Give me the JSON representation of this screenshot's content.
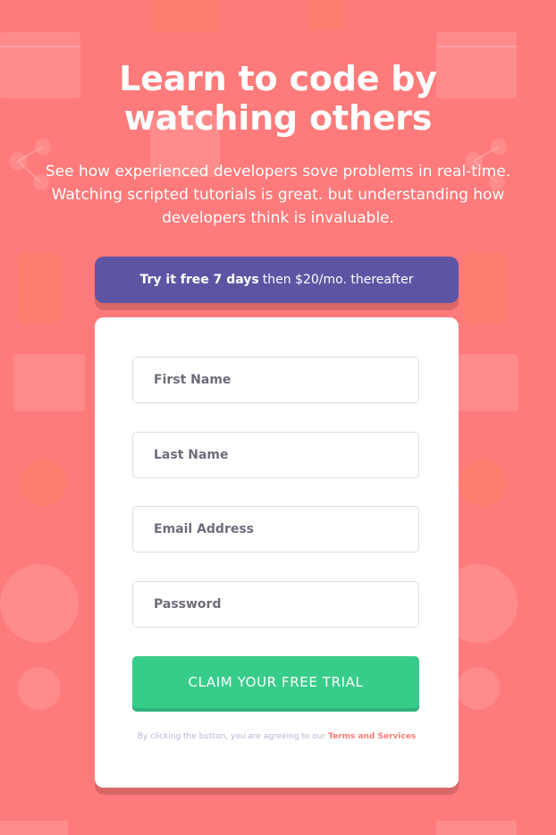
{
  "hero": {
    "title": "Learn to code by watching others",
    "description": "See how experienced developers sove problems in real-time. Watching scripted tutorials is great. but understanding how developers think is invaluable."
  },
  "promo": {
    "bold": "Try it free 7 days",
    "rest": "then $20/mo. thereafter"
  },
  "form": {
    "first_name_placeholder": "First Name",
    "last_name_placeholder": "Last Name",
    "email_placeholder": "Email Address",
    "password_placeholder": "Password",
    "submit_label": "CLAIM YOUR FREE TRIAL",
    "terms_prefix": "By clicking the button, you are agreeing to our",
    "terms_link": "Terms and Services"
  },
  "colors": {
    "background": "#ff7a7a",
    "promo": "#5e54a4",
    "cta": "#38cc8b",
    "cta_shadow": "#31b27a",
    "link": "#ff7a7a",
    "muted": "#b9b6d3"
  }
}
